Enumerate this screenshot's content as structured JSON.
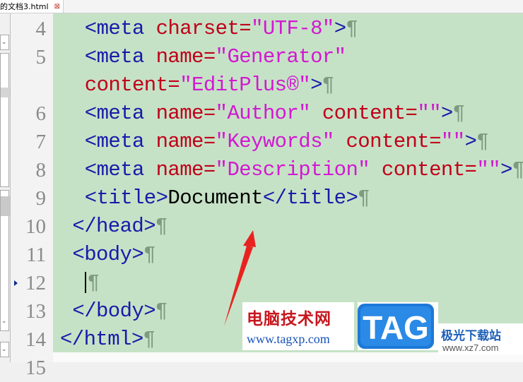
{
  "tab": {
    "title": "的文档3.html",
    "close_glyph": "⊠"
  },
  "editor": {
    "line_numbers": [
      "4",
      "5",
      "",
      "6",
      "7",
      "8",
      "9",
      "10",
      "11",
      "12",
      "13",
      "14",
      "15"
    ],
    "current_line": "12",
    "pilcrow": "¶",
    "lines": [
      {
        "indent": "  ",
        "segments": [
          {
            "t": "<meta ",
            "c": "tag"
          },
          {
            "t": "charset=",
            "c": "attr"
          },
          {
            "t": "\"UTF-8\"",
            "c": "str"
          },
          {
            "t": ">",
            "c": "tag"
          }
        ],
        "eol": true
      },
      {
        "indent": "  ",
        "segments": [
          {
            "t": "<meta ",
            "c": "tag"
          },
          {
            "t": "name=",
            "c": "attr"
          },
          {
            "t": "\"Generator\"",
            "c": "str"
          }
        ],
        "eol": false
      },
      {
        "indent": "  ",
        "segments": [
          {
            "t": "content=",
            "c": "attr"
          },
          {
            "t": "\"EditPlus®\"",
            "c": "str"
          },
          {
            "t": ">",
            "c": "tag"
          }
        ],
        "eol": true
      },
      {
        "indent": "  ",
        "segments": [
          {
            "t": "<meta ",
            "c": "tag"
          },
          {
            "t": "name=",
            "c": "attr"
          },
          {
            "t": "\"Author\" ",
            "c": "str"
          },
          {
            "t": "content=",
            "c": "attr"
          },
          {
            "t": "\"\"",
            "c": "str"
          },
          {
            "t": ">",
            "c": "tag"
          }
        ],
        "eol": true
      },
      {
        "indent": "  ",
        "segments": [
          {
            "t": "<meta ",
            "c": "tag"
          },
          {
            "t": "name=",
            "c": "attr"
          },
          {
            "t": "\"Keywords\" ",
            "c": "str"
          },
          {
            "t": "content=",
            "c": "attr"
          },
          {
            "t": "\"\"",
            "c": "str"
          },
          {
            "t": ">",
            "c": "tag"
          }
        ],
        "eol": true
      },
      {
        "indent": "  ",
        "segments": [
          {
            "t": "<meta ",
            "c": "tag"
          },
          {
            "t": "name=",
            "c": "attr"
          },
          {
            "t": "\"Description\" ",
            "c": "str"
          },
          {
            "t": "content=",
            "c": "attr"
          },
          {
            "t": "\"\"",
            "c": "str"
          },
          {
            "t": ">",
            "c": "tag"
          }
        ],
        "eol": true
      },
      {
        "indent": "  ",
        "segments": [
          {
            "t": "<title>",
            "c": "tag"
          },
          {
            "t": "Document",
            "c": "txt"
          },
          {
            "t": "</title>",
            "c": "tag"
          }
        ],
        "eol": true
      },
      {
        "indent": " ",
        "segments": [
          {
            "t": "</head>",
            "c": "tag"
          }
        ],
        "eol": true
      },
      {
        "indent": " ",
        "segments": [
          {
            "t": "<body>",
            "c": "tag"
          }
        ],
        "eol": true
      },
      {
        "indent": "  ",
        "segments": [],
        "eol": true,
        "caret": true
      },
      {
        "indent": " ",
        "segments": [
          {
            "t": "</body>",
            "c": "tag"
          }
        ],
        "eol": true
      },
      {
        "indent": "",
        "segments": [
          {
            "t": "</html>",
            "c": "tag"
          }
        ],
        "eol": true
      }
    ]
  },
  "watermark": {
    "title": "电脑技术网",
    "url": "www.tagxp.com",
    "logo_text": "TAG",
    "site_name": "极光下载站",
    "site_url": "www.xz7.com"
  },
  "colors": {
    "code_bg": "#c6e2c6",
    "tag": "#1a1aaa",
    "attr": "#c0001a",
    "string": "#d218d2",
    "annotation_arrow": "#e8231f"
  }
}
